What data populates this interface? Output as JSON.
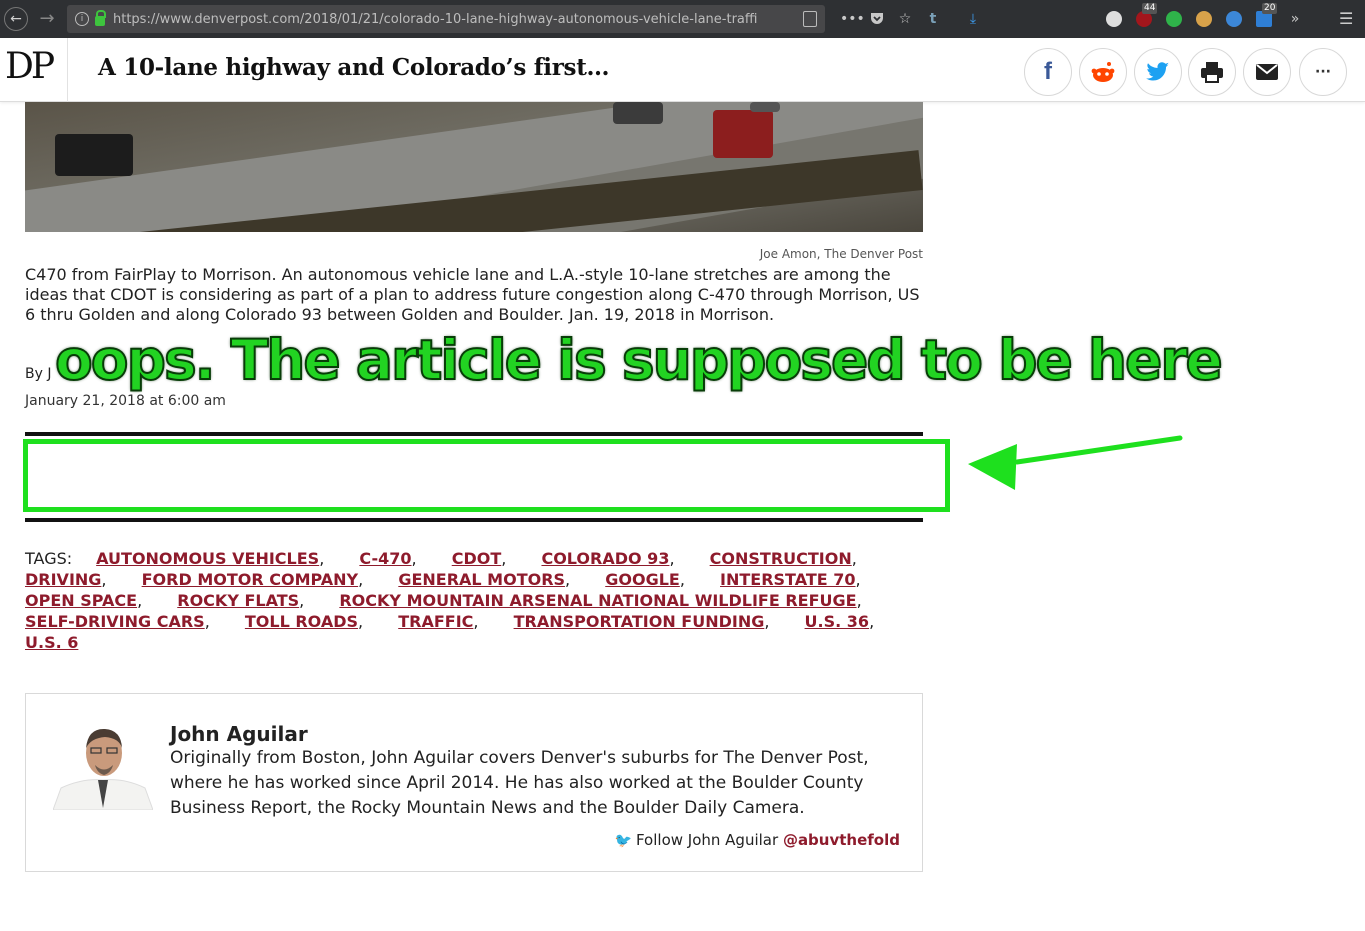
{
  "browser": {
    "url": "https://www.denverpost.com/2018/01/21/colorado-10-lane-highway-autonomous-vehicle-lane-traffi",
    "badge_left": "44",
    "badge_right": "20"
  },
  "header": {
    "logo": "DP",
    "headline": "A 10-lane highway and Colorado’s first…"
  },
  "colors": {
    "tag_link": "#8e1b2c",
    "annotation_green": "#22d322",
    "twitter_blue": "#1da1f2",
    "facebook_blue": "#3b5998",
    "reddit_orange": "#ff4500"
  },
  "photo": {
    "credit": "Joe Amon, The Denver Post",
    "caption": "C470 from FairPlay to Morrison. An autonomous vehicle lane and L.A.-style 10-lane stretches are among the ideas that CDOT is considering as part of a plan to address future congestion along C-470 through Morrison, US 6 thru Golden and along Colorado 93 between Golden and Boulder. Jan. 19, 2018 in Morrison."
  },
  "byline": {
    "prefix": "By J",
    "date": "January 21, 2018 at 6:00 am"
  },
  "annotation": {
    "text": "oops. The article is supposed to be here"
  },
  "tags": {
    "label": "TAGS:",
    "items": [
      "AUTONOMOUS VEHICLES",
      "C-470",
      "CDOT",
      "COLORADO 93",
      "CONSTRUCTION",
      "DRIVING",
      "FORD MOTOR COMPANY",
      "GENERAL MOTORS",
      "GOOGLE",
      "INTERSTATE 70",
      "OPEN SPACE",
      "ROCKY FLATS",
      "ROCKY MOUNTAIN ARSENAL NATIONAL WILDLIFE REFUGE",
      "SELF-DRIVING CARS",
      "TOLL ROADS",
      "TRAFFIC",
      "TRANSPORTATION FUNDING",
      "U.S. 36",
      "U.S. 6"
    ]
  },
  "author": {
    "name": "John Aguilar",
    "bio": "Originally from Boston, John Aguilar covers Denver's suburbs for The Denver Post, where he has worked since April 2014. He has also worked at the Boulder County Business Report, the Rocky Mountain News and the Boulder Daily Camera.",
    "follow_label": "Follow John Aguilar",
    "handle": "@abuvthefold"
  }
}
